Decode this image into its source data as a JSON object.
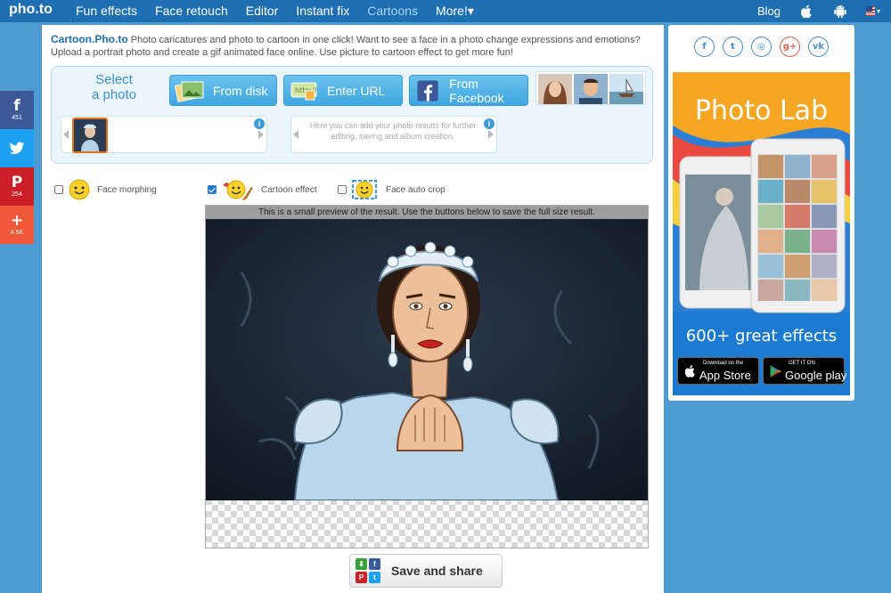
{
  "topbar": {
    "logo": "pho.to",
    "nav": [
      "Fun effects",
      "Face retouch",
      "Editor",
      "Instant fix",
      "Cartoons",
      "More!▾"
    ],
    "active_index": 4,
    "blog": "Blog",
    "icons": [
      "apple-icon",
      "android-icon",
      "us-flag-icon"
    ]
  },
  "share": [
    {
      "glyph": "f",
      "count": "451",
      "color": "#3b5998",
      "icon": "facebook-icon"
    },
    {
      "glyph": "🐦",
      "count": "",
      "color": "#1da1f2",
      "icon": "twitter-icon"
    },
    {
      "glyph": "P",
      "count": "254",
      "color": "#cb2027",
      "icon": "pinterest-icon"
    },
    {
      "glyph": "+",
      "count": "4.5K",
      "color": "#f05a3a",
      "icon": "plus-icon"
    }
  ],
  "intro": {
    "brand": "Cartoon.Pho.to",
    "text": " Photo caricatures and photo to cartoon in one click! Want to see a face in a photo change expressions and emotions? Upload a portrait photo and create a gif animated face online. Use picture to cartoon effect to get more fun!"
  },
  "upload": {
    "select_label_1": "Select",
    "select_label_2": "a photo",
    "from_disk": "From disk",
    "enter_url": "Enter URL",
    "from_facebook": "From Facebook",
    "results_hint": "Here you can add your photo results for further editing, saving and album creation."
  },
  "effects": [
    {
      "label": "Face morphing",
      "checked": false
    },
    {
      "label": "Cartoon effect",
      "checked": true
    },
    {
      "label": "Face auto crop",
      "checked": false
    }
  ],
  "preview": {
    "note": "This is a small preview of the result. Use the buttons below to save the full size result."
  },
  "save": {
    "label": "Save and share"
  },
  "right": {
    "social": [
      "f",
      "t",
      "◎",
      "g+",
      "vk"
    ],
    "social_icons": [
      "facebook-icon",
      "twitter-icon",
      "instagram-icon",
      "google-plus-icon",
      "vk-icon"
    ],
    "ad_title": "Photo Lab",
    "ad_sub": "600+ great effects",
    "app_store_small": "Download on the",
    "app_store_big": "App Store",
    "google_small": "GET IT ON",
    "google_big": "Google play"
  }
}
